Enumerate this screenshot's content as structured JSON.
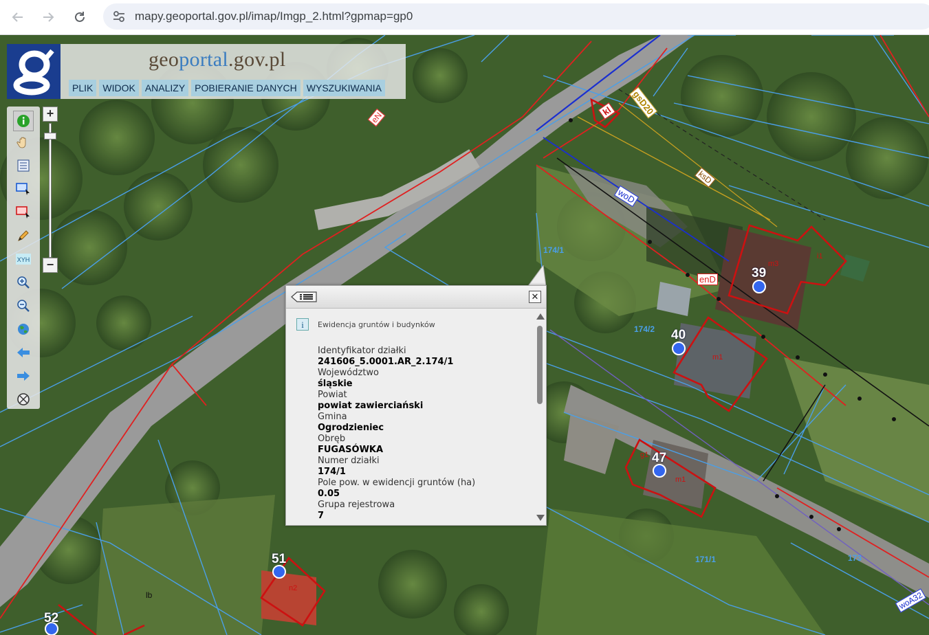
{
  "browser": {
    "url": "mapy.geoportal.gov.pl/imap/Imgp_2.html?gpmap=gp0"
  },
  "header": {
    "brand_part1": "geo",
    "brand_part2": "portal",
    "brand_part3": ".gov.pl",
    "menu": [
      "PLIK",
      "WIDOK",
      "ANALIZY",
      "POBIERANIE DANYCH",
      "WYSZUKIWANIA"
    ]
  },
  "tools": [
    "info-icon",
    "pan-hand-icon",
    "layers-list-icon",
    "select-rectangle-icon",
    "select-area-icon",
    "pencil-icon",
    "coordinates-xyh-icon",
    "zoom-in-icon",
    "zoom-out-icon",
    "globe-icon",
    "back-arrow-icon",
    "forward-arrow-icon",
    "compass-icon"
  ],
  "tool_xyh_text": "XYH",
  "zoom": {
    "plus": "+",
    "minus": "−"
  },
  "popup": {
    "section_title": "Ewidencja gruntów i budynków",
    "close": "✕",
    "fields": [
      {
        "label": "Identyfikator działki",
        "value": "241606_5.0001.AR_2.174/1"
      },
      {
        "label": "Województwo",
        "value": "śląskie"
      },
      {
        "label": "Powiat",
        "value": "powiat zawierciański"
      },
      {
        "label": "Gmina",
        "value": "Ogrodzieniec"
      },
      {
        "label": "Obręb",
        "value": "FUGASÓWKA"
      },
      {
        "label": "Numer działki",
        "value": "174/1"
      },
      {
        "label": "Pole pow. w ewidencji gruntów (ha)",
        "value": "0.05"
      },
      {
        "label": "Grupa rejestrowa",
        "value": "7"
      }
    ]
  },
  "map_labels": {
    "eN": "eN",
    "kl": "kl",
    "gsD20": "gsD20",
    "ksD": "ksD",
    "woD": "woD",
    "enD": "enD",
    "parcel_174_1_top": "174/1",
    "parcel_174_2": "174/2",
    "parcel_171_1": "171/1",
    "parcel_173": "173",
    "m3": "m3",
    "m1_a": "m1",
    "m1_b": "m1",
    "i1": "i1",
    "g1": "g1",
    "n2": "n2",
    "lb": "lb",
    "woA32": "woA32",
    "n39": "39",
    "n40": "40",
    "n47": "47",
    "n51": "51",
    "n52": "52"
  },
  "colors": {
    "parcel_lines": "#4a9fe8",
    "boundary_red": "#e02020",
    "building_outline": "#cc1111",
    "utility_blue": "#1a2fd0",
    "address_dot": "#3366ee",
    "menu_bg": "#a8cfe0",
    "logo_bg": "#1a3d8f"
  }
}
